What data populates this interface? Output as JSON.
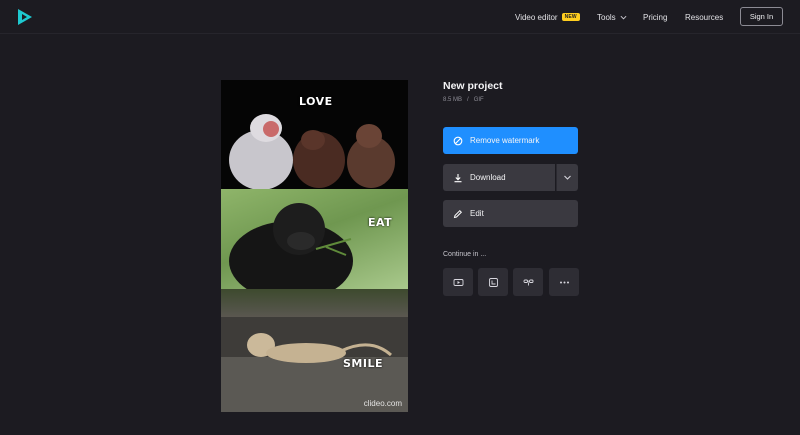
{
  "header": {
    "logo_icon": "clideo-play-logo-icon",
    "nav": {
      "video_editor": "Video editor",
      "badge": "NEW",
      "tools": "Tools",
      "pricing": "Pricing",
      "resources": "Resources"
    },
    "sign_in": "Sign In"
  },
  "preview": {
    "panels": [
      "LOVE",
      "EAT",
      "SMILE"
    ],
    "watermark": "clideo.com"
  },
  "project": {
    "title": "New project",
    "size": "8.5 MB",
    "separator": "/",
    "format": "GIF"
  },
  "actions": {
    "remove_watermark": "Remove watermark",
    "download": "Download",
    "edit": "Edit"
  },
  "continue": {
    "label": "Continue in ...",
    "options": [
      "youtube-icon",
      "crop-icon",
      "link-icon",
      "more-icon"
    ]
  },
  "colors": {
    "background": "#1c1b21",
    "accent": "#1f8fff",
    "button": "#3a3940",
    "badge": "#ffce1f"
  }
}
